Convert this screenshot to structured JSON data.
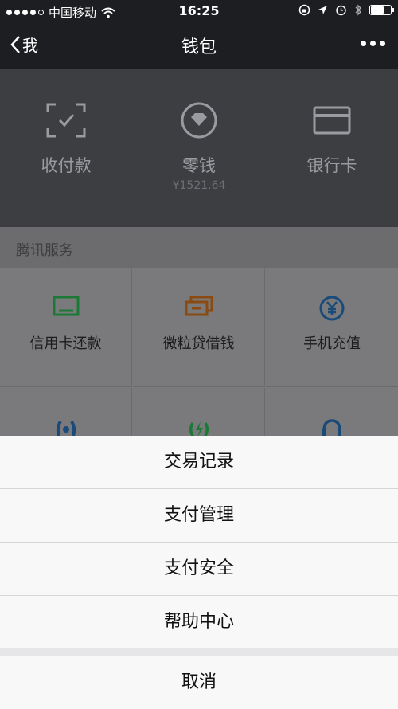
{
  "status_bar": {
    "carrier": "中国移动",
    "time": "16:25"
  },
  "nav": {
    "back_label": "我",
    "title": "钱包"
  },
  "wallet": {
    "items": [
      {
        "label": "收付款",
        "icon": "scan-frame-icon"
      },
      {
        "label": "零钱",
        "sub": "¥1521.64",
        "icon": "diamond-coin-icon"
      },
      {
        "label": "银行卡",
        "icon": "bank-card-icon"
      }
    ]
  },
  "services": {
    "title": "腾讯服务",
    "items": [
      {
        "label": "信用卡还款",
        "icon": "credit-card-repay-icon",
        "color": "#1a7a35"
      },
      {
        "label": "微粒贷借钱",
        "icon": "cash-loan-icon",
        "color": "#8a4a10"
      },
      {
        "label": "手机充值",
        "icon": "yen-coin-icon",
        "color": "#1a4a7a"
      }
    ]
  },
  "action_sheet": {
    "options": [
      "交易记录",
      "支付管理",
      "支付安全",
      "帮助中心"
    ],
    "cancel_label": "取消"
  },
  "colors": {
    "nav_background": "#1d1e22",
    "wallet_background": "#3d3e42",
    "sheet_background": "#f8f8f8"
  }
}
